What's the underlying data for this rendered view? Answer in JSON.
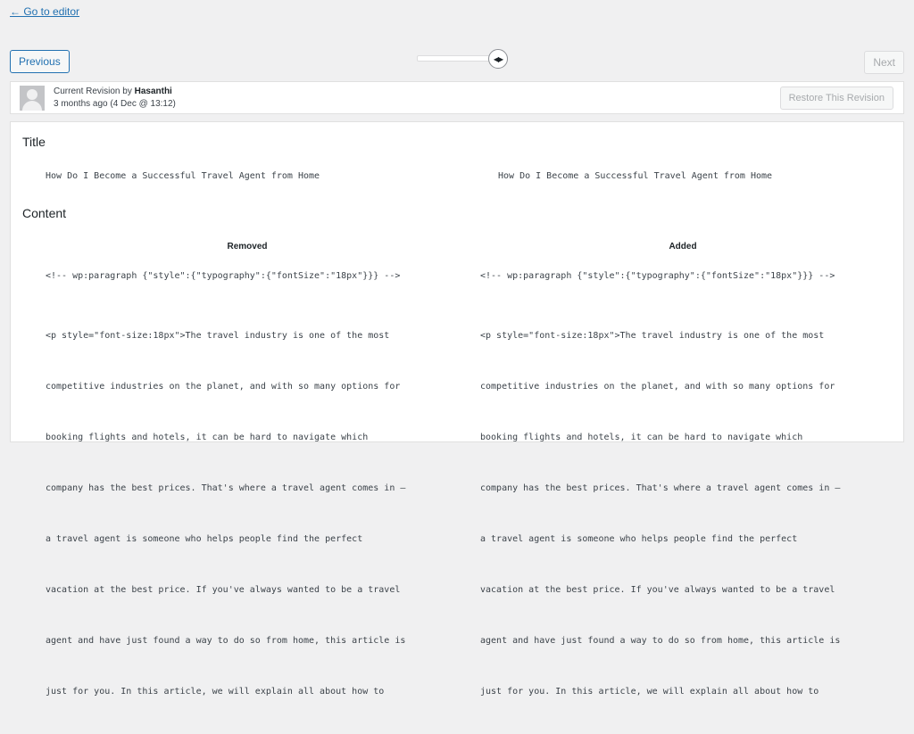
{
  "nav": {
    "back_link": "← Go to editor"
  },
  "toolbar": {
    "previous_label": "Previous",
    "next_label": "Next"
  },
  "revision": {
    "prefix": "Current Revision by ",
    "author": "Hasanthi",
    "date": "3 months ago (4 Dec @ 13:12)",
    "restore_label": "Restore This Revision"
  },
  "diff": {
    "title_heading": "Title",
    "title_left": "How Do I Become a Successful Travel Agent from Home",
    "title_right": "How Do I Become a Successful Travel Agent from Home",
    "content_heading": "Content",
    "removed_label": "Removed",
    "added_label": "Added",
    "block_comment": "<!-- wp:paragraph {\"style\":{\"typography\":{\"fontSize\":\"18px\"}}} -->",
    "paragraph_lines": [
      "<p style=\"font-size:18px\">The travel industry is one of the most",
      "competitive industries on the planet, and with so many options for",
      "booking flights and hotels, it can be hard to navigate which",
      "company has the best prices. That's where a travel agent comes in –",
      "a travel agent is someone who helps people find the perfect",
      "vacation at the best price. If you've always wanted to be a travel",
      "agent and have just found a way to do so from home, this article is",
      "just for you. In this article, we will explain all about how to"
    ]
  }
}
